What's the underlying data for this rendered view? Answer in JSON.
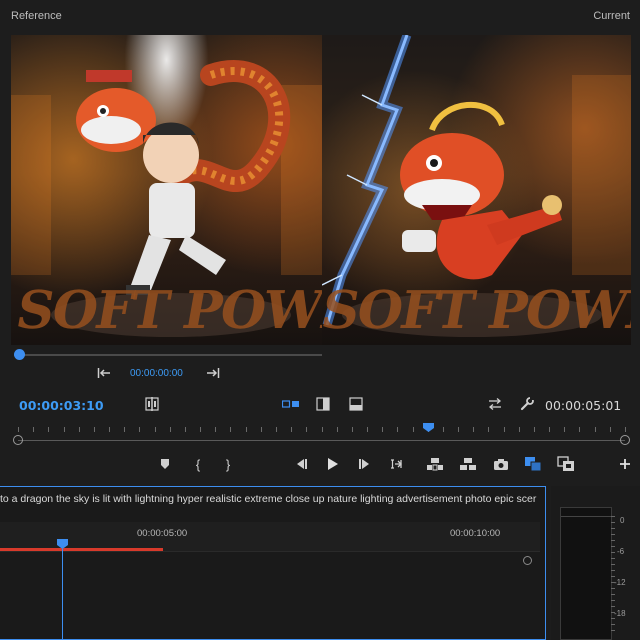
{
  "panels": {
    "reference_label": "Reference",
    "current_label": "Current"
  },
  "reference_monitor": {
    "timecode": "00:00:00:00",
    "overlay_text": "SOFT POWE"
  },
  "current_monitor": {
    "overlay_text": "SOFT POWE"
  },
  "program_monitor": {
    "current_time": "00:00:03:10",
    "duration": "00:00:05:01",
    "icons": [
      "split-view-icon",
      "side-by-side-icon",
      "vertical-split-icon",
      "horizontal-split-icon",
      "swap-icon",
      "wrench-icon"
    ],
    "transport_icons": [
      "marker-icon",
      "mark-in-icon",
      "mark-out-icon",
      "go-to-in-icon",
      "step-back-icon",
      "play-icon",
      "step-forward-icon",
      "go-to-out-icon",
      "lift-icon",
      "extract-icon",
      "camera-icon",
      "comparison-view-icon",
      "proxy-toggle-icon",
      "add-button-icon"
    ],
    "playhead_fraction": 0.67
  },
  "timeline": {
    "sequence_name": "to a dragon the sky is lit with lightning hyper realistic extreme close up nature lighting advertisement photo epic scer",
    "ruler_labels": [
      "00:00:05:00",
      "00:00:10:00"
    ],
    "accent_color": "#3d8ef0",
    "workarea_color": "#d83a2b"
  },
  "audio_meter": {
    "scale": [
      "0",
      "-6",
      "-12",
      "-18"
    ]
  }
}
